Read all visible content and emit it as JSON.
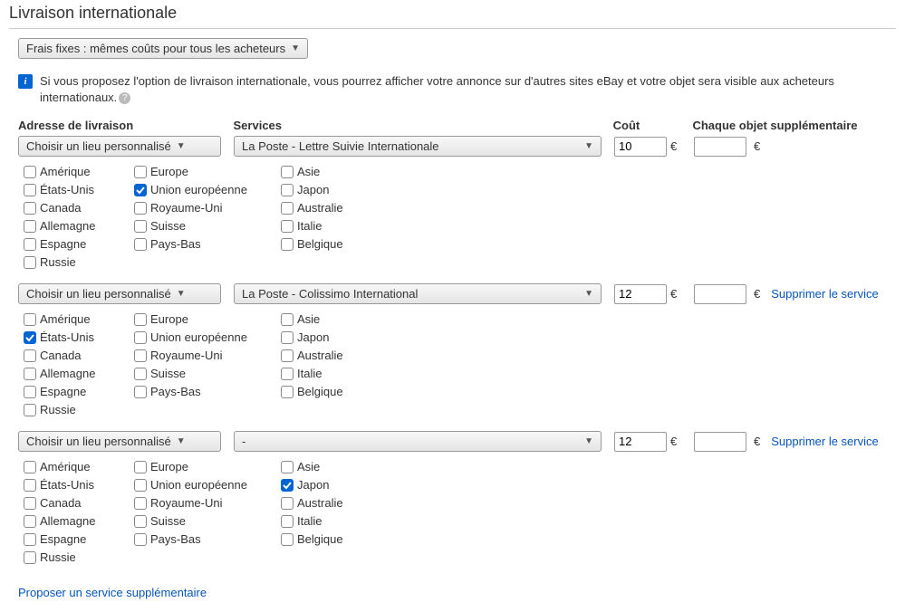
{
  "title": "Livraison internationale",
  "cost_type": "Frais fixes : mêmes coûts pour tous les acheteurs",
  "info_text": "Si vous proposez l'option de livraison internationale, vous pourrez afficher votre annonce sur d'autres sites eBay et votre objet sera visible aux acheteurs internationaux.",
  "headers": {
    "location": "Adresse de livraison",
    "service": "Services",
    "cost": "Coût",
    "each_extra": "Chaque objet supplémentaire"
  },
  "remove_label": "Supprimer le service",
  "add_service_label": "Proposer un service supplémentaire",
  "currency_symbol": "€",
  "location_select_label": "Choisir un lieu personnalisé",
  "country_columns": [
    [
      "Amérique",
      "États-Unis",
      "Canada",
      "Allemagne",
      "Espagne",
      "Russie"
    ],
    [
      "Europe",
      "Union européenne",
      "Royaume-Uni",
      "Suisse",
      "Pays-Bas"
    ],
    [
      "Asie",
      "Japon",
      "Australie",
      "Italie",
      "Belgique"
    ]
  ],
  "services": [
    {
      "service_name": "La Poste - Lettre Suivie Internationale",
      "cost": "10",
      "extra": "",
      "removable": false,
      "checked": [
        "Union européenne"
      ]
    },
    {
      "service_name": "La Poste - Colissimo International",
      "cost": "12",
      "extra": "",
      "removable": true,
      "checked": [
        "États-Unis"
      ]
    },
    {
      "service_name": "-",
      "cost": "12",
      "extra": "",
      "removable": true,
      "checked": [
        "Japon"
      ]
    }
  ]
}
